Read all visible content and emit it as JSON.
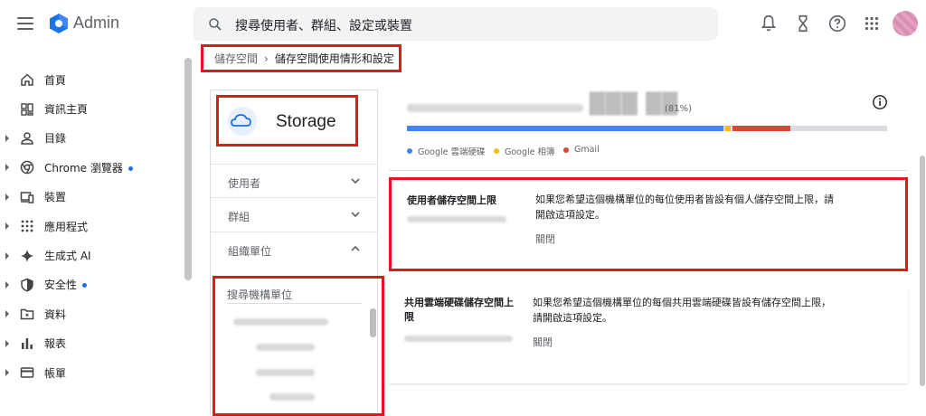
{
  "app": {
    "brand": "Admin",
    "search_placeholder": "搜尋使用者、群組、設定或裝置"
  },
  "topbar_icons": [
    "notifications-icon",
    "hourglass-icon",
    "help-icon",
    "apps-grid-icon"
  ],
  "sidebar": {
    "items": [
      {
        "label": "首頁",
        "icon": "home-icon",
        "expandable": false,
        "dot": false
      },
      {
        "label": "資訊主頁",
        "icon": "dashboard-icon",
        "expandable": false,
        "dot": false
      },
      {
        "label": "目錄",
        "icon": "person-icon",
        "expandable": true,
        "dot": false
      },
      {
        "label": "Chrome 瀏覽器",
        "icon": "chrome-icon",
        "expandable": true,
        "dot": true
      },
      {
        "label": "裝置",
        "icon": "devices-icon",
        "expandable": true,
        "dot": false
      },
      {
        "label": "應用程式",
        "icon": "apps-icon",
        "expandable": true,
        "dot": false
      },
      {
        "label": "生成式 AI",
        "icon": "sparkle-icon",
        "expandable": true,
        "dot": false
      },
      {
        "label": "安全性",
        "icon": "shield-icon",
        "expandable": true,
        "dot": true
      },
      {
        "label": "資料",
        "icon": "folder-icon",
        "expandable": true,
        "dot": false
      },
      {
        "label": "報表",
        "icon": "bar-chart-icon",
        "expandable": true,
        "dot": false
      },
      {
        "label": "帳單",
        "icon": "credit-card-icon",
        "expandable": true,
        "dot": false
      }
    ]
  },
  "breadcrumb": {
    "parent": "儲存空間",
    "separator": "›",
    "current": "儲存空間使用情形和設定"
  },
  "left_panel": {
    "title": "Storage",
    "sections": [
      {
        "label": "使用者",
        "expanded": false
      },
      {
        "label": "群組",
        "expanded": false
      },
      {
        "label": "組織單位",
        "expanded": true
      }
    ],
    "org_search_placeholder": "搜尋機構單位"
  },
  "usage": {
    "percent_text": "(81%)",
    "segments": [
      {
        "name": "Google 雲端硬碟",
        "color": "#4285f4",
        "fraction": 0.66
      },
      {
        "name": "Google 相簿",
        "color": "#fbbc04",
        "fraction": 0.012
      },
      {
        "name": "Gmail",
        "color": "#db4437",
        "fraction": 0.12
      }
    ],
    "legend": [
      "Google 雲端硬碟",
      "Google 相簿",
      "Gmail"
    ]
  },
  "settings": [
    {
      "title": "使用者儲存空間上限",
      "description": "如果您希望這個機構單位的每位使用者皆設有個人儲存空間上限，請開啟這項設定。",
      "status": "關閉"
    },
    {
      "title": "共用雲端硬碟儲存空間上限",
      "description": "如果您希望這個機構單位的每個共用雲端硬碟皆設有儲存空間上限，請開啟這項設定。",
      "status": "關閉"
    }
  ],
  "colors": {
    "highlight": "#e0171d",
    "accent": "#1a73e8"
  }
}
